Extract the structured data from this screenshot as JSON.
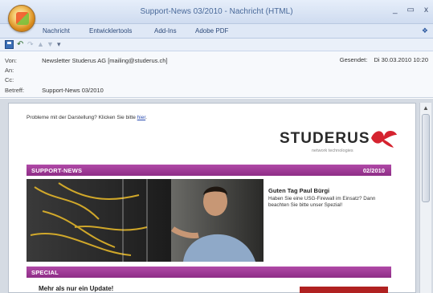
{
  "window": {
    "title": "Support-News 03/2010 - Nachricht (HTML)",
    "controls": {
      "minimize": "_",
      "maximize": "▭",
      "close": "x"
    }
  },
  "ribbon": {
    "tabs": [
      "Nachricht",
      "Entwicklertools",
      "Add-Ins",
      "Adobe PDF"
    ]
  },
  "header": {
    "from_label": "Von:",
    "from_value": "Newsletter Studerus AG [mailing@studerus.ch]",
    "to_label": "An:",
    "to_value": "",
    "cc_label": "Cc:",
    "cc_value": "",
    "subject_label": "Betreff:",
    "subject_value": "Support-News 03/2010",
    "sent_label": "Gesendet:",
    "sent_value": "Di 30.03.2010 10:20"
  },
  "newsletter": {
    "problem_text": "Probleme mit der Darstellung? Klicken Sie bitte",
    "problem_link": "hier",
    "logo_text": "STUDERUS",
    "logo_tagline": "network technologies",
    "band1_left": "SUPPORT-NEWS",
    "band1_right": "02/2010",
    "greeting_title": "Guten Tag Paul Bürgi",
    "greeting_text": "Haben Sie eine USG-Firewall im Einsatz? Dann beachten Sie bitte unser Spezial!",
    "band2_left": "SPECIAL",
    "special_title": "Mehr als nur ein Update!"
  },
  "colors": {
    "band": "#9a3a92",
    "logo_red": "#d5232f",
    "red_block": "#b02121"
  }
}
